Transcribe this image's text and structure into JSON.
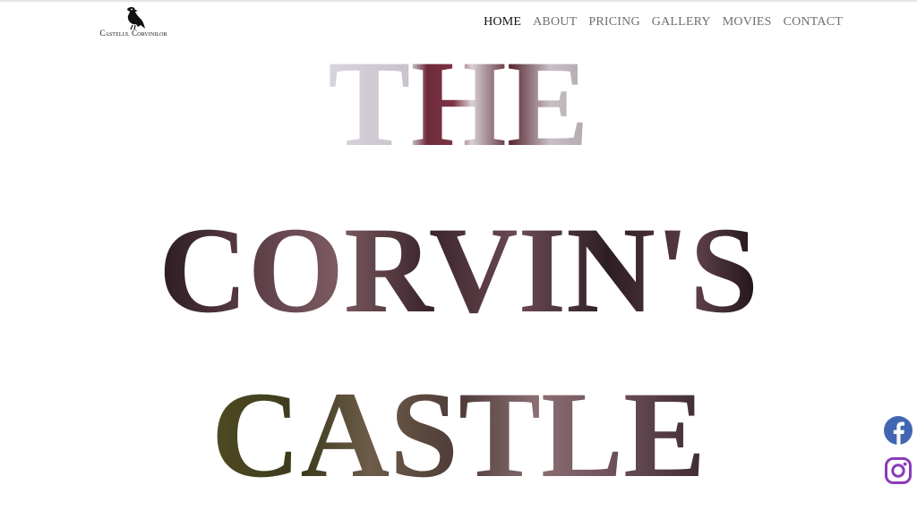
{
  "logo": {
    "text": "Castelul Corvinilor",
    "icon": "raven-icon"
  },
  "nav": {
    "items": [
      {
        "label": "HOME",
        "active": true
      },
      {
        "label": "ABOUT",
        "active": false
      },
      {
        "label": "PRICING",
        "active": false
      },
      {
        "label": "GALLERY",
        "active": false
      },
      {
        "label": "MOVIES",
        "active": false
      },
      {
        "label": "CONTACT",
        "active": false
      }
    ]
  },
  "hero": {
    "line1": "THE",
    "line2": "CORVIN'S",
    "line3": "CASTLE"
  },
  "social": {
    "facebook_icon": "facebook-icon",
    "instagram_icon": "instagram-icon"
  },
  "colors": {
    "nav_active": "#111111",
    "nav_inactive": "#6e6e6e",
    "facebook": "#4267b2",
    "instagram": "#8a3ab9"
  }
}
